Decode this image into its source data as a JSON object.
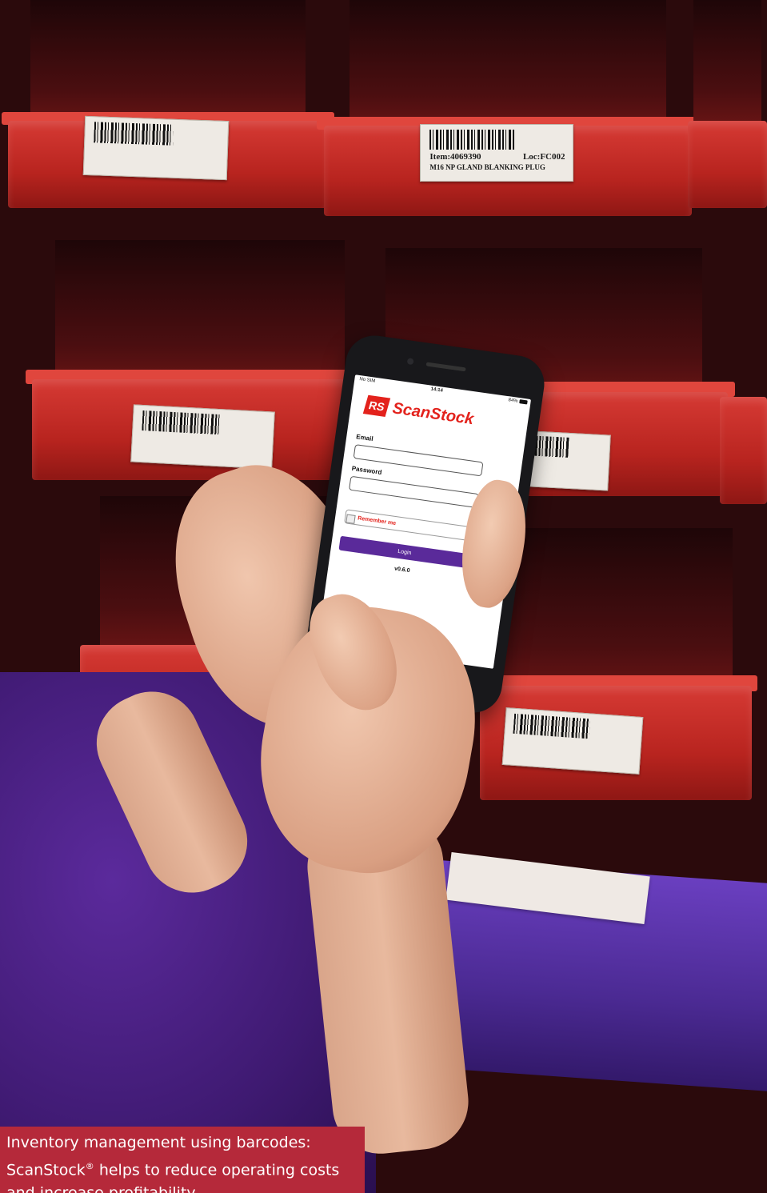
{
  "photo": {
    "subject": "hands-holding-phone-in-front-of-red-storage-bins",
    "bin_labels": [
      {
        "item": "Item:4069390",
        "loc": "Loc:FC002",
        "desc": "M16 NP GLAND BLANKING PLUG"
      }
    ]
  },
  "phone_app": {
    "status_carrier": "No SIM",
    "status_time": "14:14",
    "status_battery": "84%",
    "brand_badge": "RS",
    "brand_name": "ScanStock",
    "email_label": "Email",
    "password_label": "Password",
    "remember_label": "Remember me",
    "login_label": "Login",
    "version": "v0.6.0"
  },
  "caption": {
    "line1": "Inventory management using barcodes:",
    "line2_prefix": "ScanStock",
    "line2_mark": "®",
    "line2_suffix": " helps to reduce operating costs",
    "line3": "and increase profitability."
  },
  "colors": {
    "bin_red": "#c62c25",
    "brand_red": "#e3221c",
    "login_purple": "#5a2a9a",
    "caption_bg": "#b5293a",
    "shirt_purple": "#4b2285"
  }
}
